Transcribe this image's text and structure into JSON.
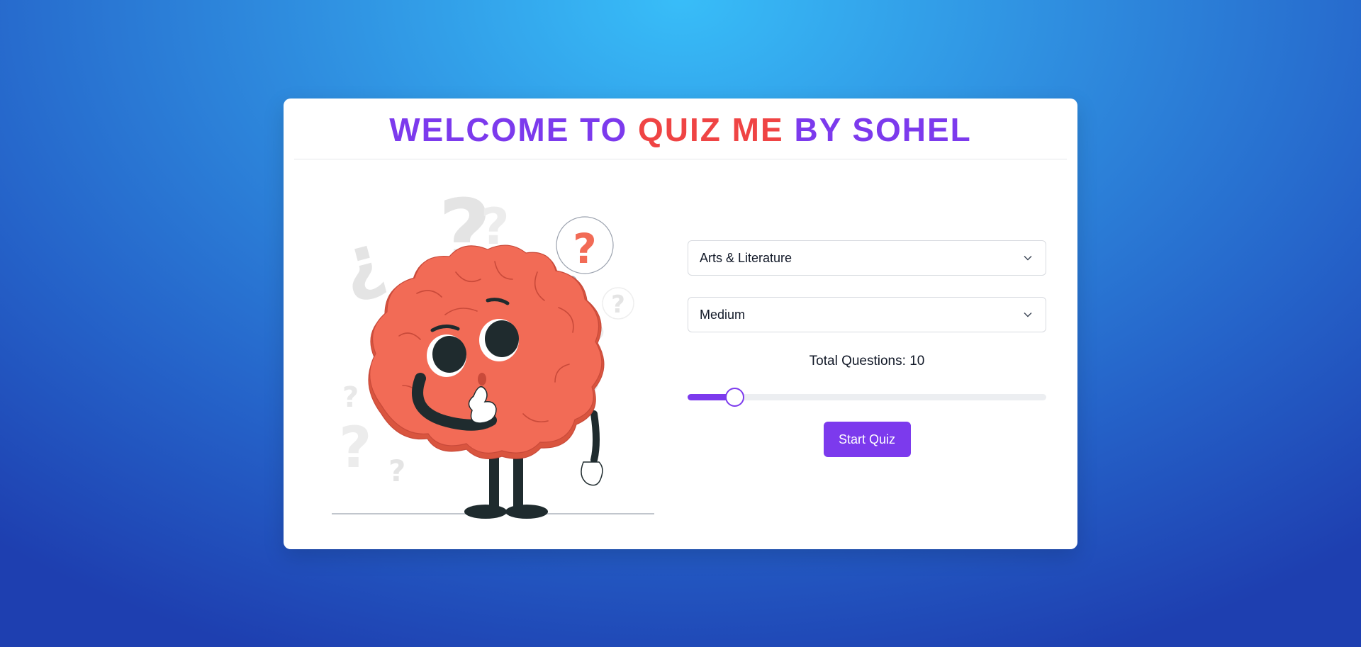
{
  "header": {
    "title_part1": "WELCOME TO ",
    "title_part2": "QUIZ ME",
    "title_part3": " BY SOHEL"
  },
  "form": {
    "category": {
      "selected": "Arts & Literature"
    },
    "difficulty": {
      "selected": "Medium"
    },
    "total_label": "Total Questions:",
    "total_value": "10",
    "slider_fraction": 0.13,
    "start_label": "Start Quiz"
  },
  "colors": {
    "accent": "#7c3aed",
    "highlight": "#ef4444",
    "brain": "#f26b56"
  },
  "icons": [
    "chevron-down-icon",
    "brain-character-illustration",
    "question-mark-icon"
  ]
}
